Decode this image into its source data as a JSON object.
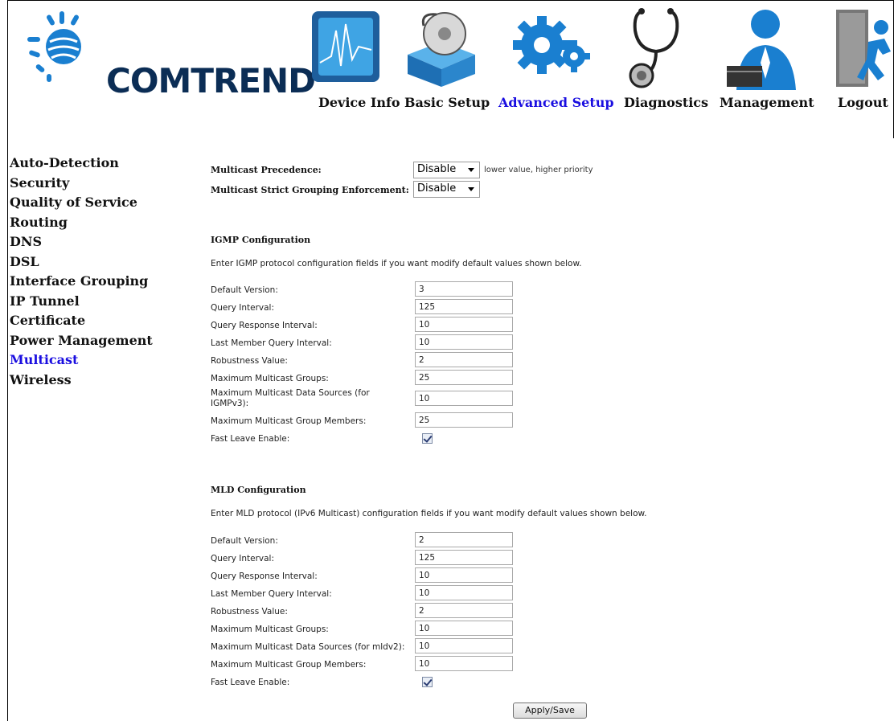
{
  "brand": {
    "name": "COMTREND"
  },
  "nav": [
    {
      "label": "Device Info",
      "icon": "monitor-chart-icon",
      "active": false
    },
    {
      "label": "Basic Setup",
      "icon": "disc-box-icon",
      "active": false
    },
    {
      "label": "Advanced Setup",
      "icon": "gears-icon",
      "active": true
    },
    {
      "label": "Diagnostics",
      "icon": "stethoscope-icon",
      "active": false
    },
    {
      "label": "Management",
      "icon": "user-laptop-icon",
      "active": false
    },
    {
      "label": "Logout",
      "icon": "exit-door-icon",
      "active": false
    }
  ],
  "sidebar": {
    "items": [
      {
        "label": "Auto-Detection",
        "active": false
      },
      {
        "label": "Security",
        "active": false
      },
      {
        "label": "Quality of Service",
        "active": false
      },
      {
        "label": "Routing",
        "active": false
      },
      {
        "label": "DNS",
        "active": false
      },
      {
        "label": "DSL",
        "active": false
      },
      {
        "label": "Interface Grouping",
        "active": false
      },
      {
        "label": "IP Tunnel",
        "active": false
      },
      {
        "label": "Certificate",
        "active": false
      },
      {
        "label": "Power Management",
        "active": false
      },
      {
        "label": "Multicast",
        "active": true
      },
      {
        "label": "Wireless",
        "active": false
      }
    ]
  },
  "multicast": {
    "precedence_label": "Multicast Precedence:",
    "precedence_value": "Disable",
    "precedence_hint": "lower value, higher priority",
    "strict_label": "Multicast Strict Grouping Enforcement:",
    "strict_value": "Disable"
  },
  "igmp": {
    "title": "IGMP Configuration",
    "description": "Enter IGMP protocol configuration fields if you want modify default values shown below.",
    "fields": [
      {
        "label": "Default Version:",
        "value": "3"
      },
      {
        "label": "Query Interval:",
        "value": "125"
      },
      {
        "label": "Query Response Interval:",
        "value": "10"
      },
      {
        "label": "Last Member Query Interval:",
        "value": "10"
      },
      {
        "label": "Robustness Value:",
        "value": "2"
      },
      {
        "label": "Maximum Multicast Groups:",
        "value": "25"
      },
      {
        "label": "Maximum Multicast Data Sources (for",
        "label2": "IGMPv3):",
        "value": "10"
      },
      {
        "label": "Maximum Multicast Group Members:",
        "value": "25"
      }
    ],
    "fast_leave_label": "Fast Leave Enable:",
    "fast_leave_checked": true
  },
  "mld": {
    "title": "MLD Configuration",
    "description": "Enter MLD protocol (IPv6 Multicast) configuration fields if you want modify default values shown below.",
    "fields": [
      {
        "label": "Default Version:",
        "value": "2"
      },
      {
        "label": "Query Interval:",
        "value": "125"
      },
      {
        "label": "Query Response Interval:",
        "value": "10"
      },
      {
        "label": "Last Member Query Interval:",
        "value": "10"
      },
      {
        "label": "Robustness Value:",
        "value": "2"
      },
      {
        "label": "Maximum Multicast Groups:",
        "value": "10"
      },
      {
        "label": "Maximum Multicast Data Sources (for mldv2):",
        "value": "10"
      },
      {
        "label": "Maximum Multicast Group Members:",
        "value": "10"
      }
    ],
    "fast_leave_label": "Fast Leave Enable:",
    "fast_leave_checked": true
  },
  "apply_label": "Apply/Save",
  "colors": {
    "brand_navy": "#0b2d55",
    "accent_blue": "#1a7fd0",
    "active_link": "#1a0ee0"
  }
}
